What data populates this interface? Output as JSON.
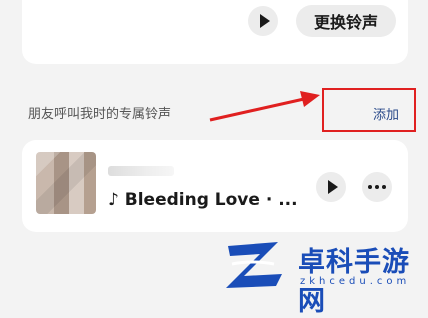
{
  "top_card": {
    "change_ringtone_label": "更换铃声"
  },
  "section": {
    "label": "朋友呼叫我时的专属铃声",
    "add_label": "添加"
  },
  "song": {
    "title": "♪ Bleeding Love · ..."
  },
  "watermark": {
    "name": "卓科手游网",
    "domain": "zkhcedu.com"
  },
  "colors": {
    "highlight_border": "#e02020",
    "add_text": "#2a4a8a",
    "watermark": "#1a4db8"
  }
}
